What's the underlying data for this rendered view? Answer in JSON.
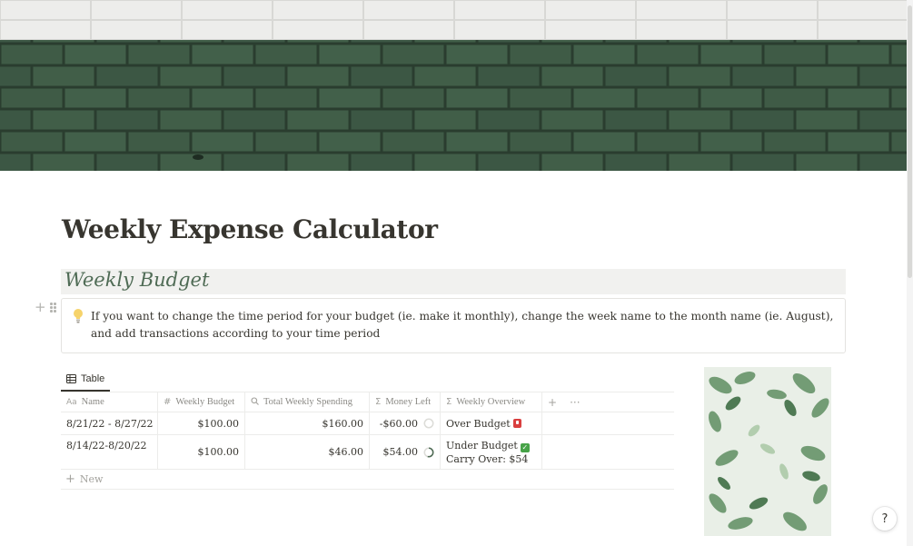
{
  "page": {
    "title": "Weekly Expense Calculator",
    "heading": "Weekly Budget",
    "callout": {
      "icon": "lightbulb-icon",
      "text": "If you want to change the time period for your budget (ie. make it monthly), change the week name to the month name (ie. August), and add transactions according to your time period"
    }
  },
  "handles": {
    "plus": "+",
    "plus_icon": "plus-icon",
    "drag_icon": "drag-handle-icon"
  },
  "database": {
    "view_tab": {
      "label": "Table",
      "icon": "table-icon"
    },
    "columns": [
      {
        "label": "Name",
        "icon": "Aa"
      },
      {
        "label": "Weekly Budget",
        "icon": "#"
      },
      {
        "label": "Total Weekly Spending",
        "icon": "search-icon"
      },
      {
        "label": "Money Left",
        "icon": "Σ"
      },
      {
        "label": "Weekly Overview",
        "icon": "Σ"
      }
    ],
    "add_column": "+",
    "more_options": "···",
    "rows": [
      {
        "name": "8/21/22 - 8/27/22",
        "weekly_budget": "$100.00",
        "total_spending": "$160.00",
        "money_left": "-$60.00",
        "money_left_progress": 0,
        "overview_line1": "Over Budget",
        "overview_badge": "over-budget-badge-icon"
      },
      {
        "name": "8/14/22-8/20/22",
        "weekly_budget": "$100.00",
        "total_spending": "$46.00",
        "money_left": "$54.00",
        "money_left_progress": 0.54,
        "overview_line1": "Under Budget",
        "overview_badge": "check-badge-icon",
        "overview_line2": "Carry Over: $54"
      }
    ],
    "new_row": {
      "plus": "+",
      "label": "New"
    }
  },
  "help": {
    "label": "?"
  },
  "colors": {
    "heading_bg": "#f1f1ef",
    "heading_text": "#4f6b55",
    "cover_green": "#3e5a45",
    "cover_top": "#e8e8e6",
    "over_budget": "#d93f3f",
    "under_budget": "#47a348",
    "progress_ring": "#4f6b55"
  }
}
